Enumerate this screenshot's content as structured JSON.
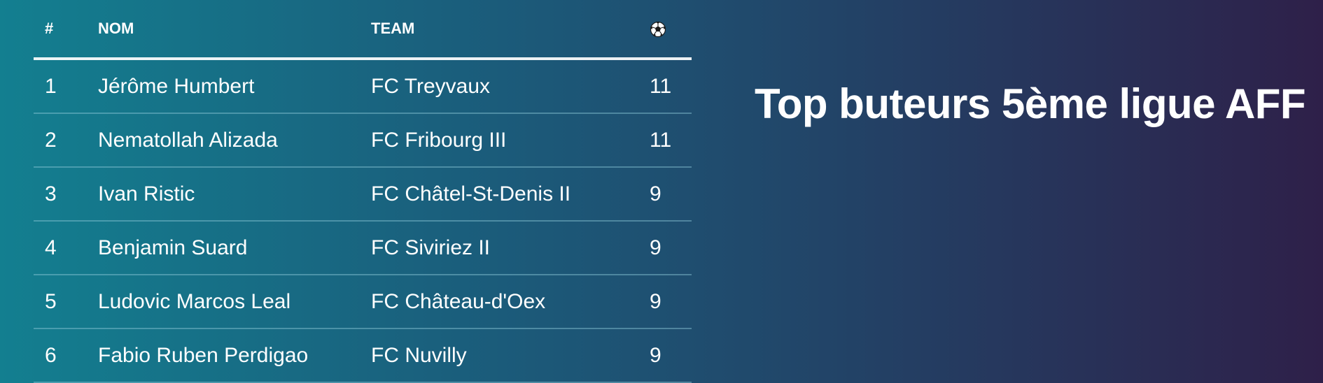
{
  "title": "Top buteurs 5ème ligue AFF",
  "table": {
    "headers": {
      "rank": "#",
      "name": "NOM",
      "team": "TEAM",
      "goals_icon": "soccer-ball-icon"
    },
    "rows": [
      {
        "rank": "1",
        "name": "Jérôme Humbert",
        "team": "FC Treyvaux",
        "goals": "11"
      },
      {
        "rank": "2",
        "name": "Nematollah Alizada",
        "team": "FC Fribourg III",
        "goals": "11"
      },
      {
        "rank": "3",
        "name": "Ivan Ristic",
        "team": "FC Châtel-St-Denis II",
        "goals": "9"
      },
      {
        "rank": "4",
        "name": "Benjamin Suard",
        "team": "FC Siviriez II",
        "goals": "9"
      },
      {
        "rank": "5",
        "name": "Ludovic Marcos Leal",
        "team": "FC Château-d'Oex",
        "goals": "9"
      },
      {
        "rank": "6",
        "name": "Fabio Ruben Perdigao",
        "team": "FC Nuvilly",
        "goals": "9"
      }
    ]
  },
  "colors": {
    "gradient_start": "#137f90",
    "gradient_end": "#2e2049",
    "text": "#ffffff"
  }
}
